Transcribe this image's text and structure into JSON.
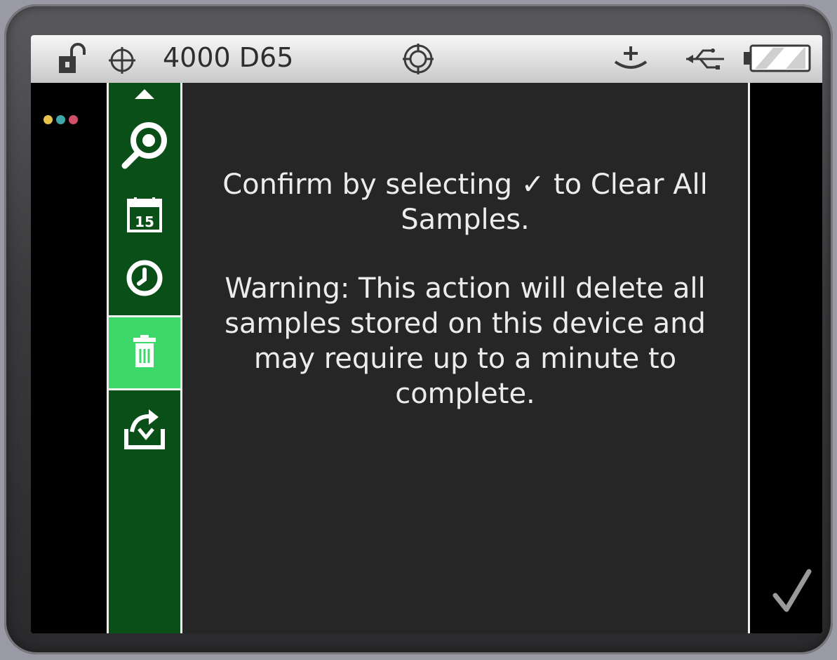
{
  "status_bar": {
    "title": "4000 D65",
    "icons": [
      "unlock-icon",
      "target-icon",
      "aperture-icon",
      "dock-icon",
      "usb-icon",
      "battery-icon"
    ]
  },
  "indicator_dots": [
    "#e8c24a",
    "#3fa7a7",
    "#d0506a"
  ],
  "sidebar": {
    "items": [
      {
        "icon": "scroll-up-icon"
      },
      {
        "icon": "sample-search-icon"
      },
      {
        "icon": "calendar-icon",
        "text": "15"
      },
      {
        "icon": "clock-icon"
      },
      {
        "icon": "trash-icon",
        "active": true
      },
      {
        "icon": "export-icon"
      }
    ]
  },
  "dialog": {
    "confirm_text": "Confirm by selecting ✓ to Clear All Samples.",
    "warning_text": "Warning: This action will delete all samples stored on this device and may require up to a minute to complete."
  },
  "confirm_icon": "checkmark-icon",
  "colors": {
    "sidebar_bg": "#0a4f17",
    "sidebar_active": "#3cd86a",
    "main_bg": "#262626",
    "text": "#ececec"
  }
}
